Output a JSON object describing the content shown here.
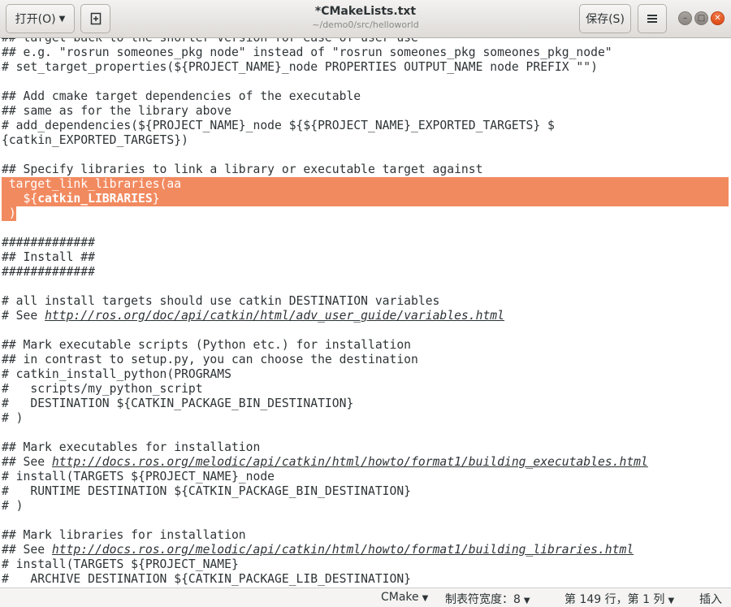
{
  "header": {
    "open_label": "打开(O)",
    "title": "*CMakeLists.txt",
    "subtitle": "~/demo0/src/helloworld",
    "save_label": "保存(S)",
    "icons": {
      "open_dropdown": "chevron-down-icon",
      "new_document": "new-document-icon",
      "menu": "hamburger-menu-icon",
      "minimize": "minimize-icon",
      "maximize": "maximize-icon",
      "close": "close-icon"
    }
  },
  "editor": {
    "lines": [
      {
        "text": "## target back to the shorter version for ease of user use"
      },
      {
        "text": "## e.g. \"rosrun someones_pkg node\" instead of \"rosrun someones_pkg someones_pkg_node\""
      },
      {
        "text": "# set_target_properties(${PROJECT_NAME}_node PROPERTIES OUTPUT_NAME node PREFIX \"\")"
      },
      {
        "text": ""
      },
      {
        "text": "## Add cmake target dependencies of the executable"
      },
      {
        "text": "## same as for the library above"
      },
      {
        "text": "# add_dependencies(${PROJECT_NAME}_node ${${PROJECT_NAME}_EXPORTED_TARGETS} $"
      },
      {
        "text": "{catkin_EXPORTED_TARGETS})"
      },
      {
        "text": ""
      },
      {
        "text": "## Specify libraries to link a library or executable target against"
      },
      {
        "text": " target_link_libraries(aa",
        "selected": true
      },
      {
        "pre": "   ${",
        "bold": "catkin_LIBRARIES",
        "post": "}",
        "selected": true
      },
      {
        "text": " )",
        "selected": true,
        "partial": true
      },
      {
        "text": ""
      },
      {
        "text": "#############"
      },
      {
        "text": "## Install ##"
      },
      {
        "text": "#############"
      },
      {
        "text": ""
      },
      {
        "text": "# all install targets should use catkin DESTINATION variables"
      },
      {
        "pre": "# See ",
        "link": "http://ros.org/doc/api/catkin/html/adv_user_guide/variables.html"
      },
      {
        "text": ""
      },
      {
        "text": "## Mark executable scripts (Python etc.) for installation"
      },
      {
        "text": "## in contrast to setup.py, you can choose the destination"
      },
      {
        "text": "# catkin_install_python(PROGRAMS"
      },
      {
        "text": "#   scripts/my_python_script"
      },
      {
        "text": "#   DESTINATION ${CATKIN_PACKAGE_BIN_DESTINATION}"
      },
      {
        "text": "# )"
      },
      {
        "text": ""
      },
      {
        "text": "## Mark executables for installation"
      },
      {
        "pre": "## See ",
        "link": "http://docs.ros.org/melodic/api/catkin/html/howto/format1/building_executables.html"
      },
      {
        "text": "# install(TARGETS ${PROJECT_NAME}_node"
      },
      {
        "text": "#   RUNTIME DESTINATION ${CATKIN_PACKAGE_BIN_DESTINATION}"
      },
      {
        "text": "# )"
      },
      {
        "text": ""
      },
      {
        "text": "## Mark libraries for installation"
      },
      {
        "pre": "## See ",
        "link": "http://docs.ros.org/melodic/api/catkin/html/howto/format1/building_libraries.html"
      },
      {
        "text": "# install(TARGETS ${PROJECT_NAME}"
      },
      {
        "text": "#   ARCHIVE DESTINATION ${CATKIN_PACKAGE_LIB_DESTINATION}"
      }
    ]
  },
  "status": {
    "language": "CMake",
    "tab_width": "制表符宽度：8",
    "position": "第 149 行，第 1 列",
    "mode": "插入"
  },
  "colors": {
    "selection": "#f28a60",
    "close_button": "#e95420"
  }
}
